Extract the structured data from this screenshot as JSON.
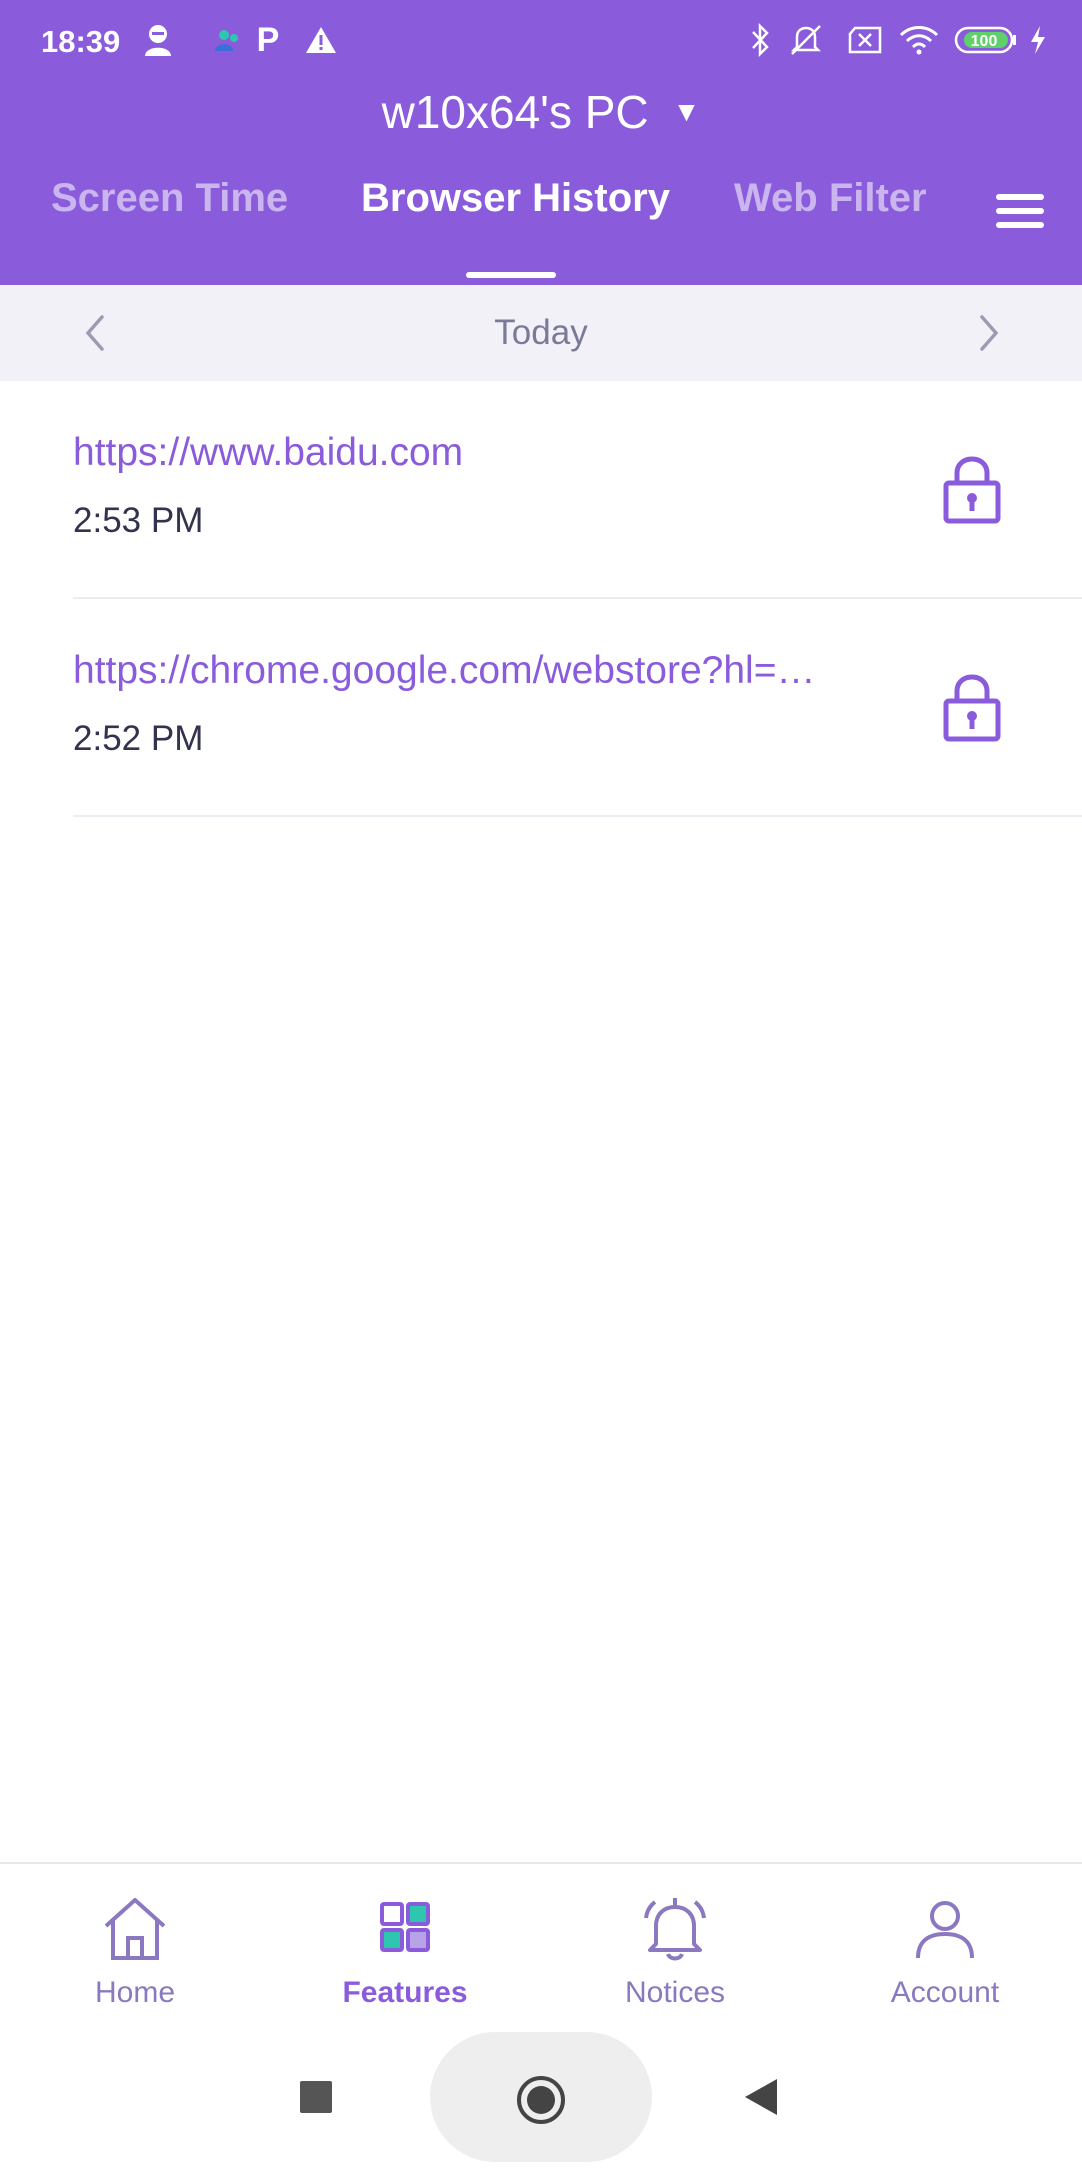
{
  "status_bar": {
    "time": "18:39",
    "battery": "100",
    "icons": [
      "face-icon",
      "people-icon",
      "parking-icon",
      "warning-icon",
      "bluetooth-icon",
      "muted-bell-icon",
      "sim-x-icon",
      "wifi-icon",
      "battery-icon",
      "charging-icon"
    ]
  },
  "header": {
    "device_name": "w10x64's PC",
    "caret": "▼",
    "tabs": [
      {
        "label": "Screen Time",
        "active": false
      },
      {
        "label": "Browser History",
        "active": true
      },
      {
        "label": "Web Filter",
        "active": false
      }
    ]
  },
  "date_nav": {
    "label": "Today"
  },
  "history": [
    {
      "url": "https://www.baidu.com",
      "time": "2:53 PM"
    },
    {
      "url": "https://chrome.google.com/webstore?hl=…",
      "time": "2:52 PM"
    }
  ],
  "bottom_nav": [
    {
      "label": "Home",
      "icon": "home-icon",
      "active": false
    },
    {
      "label": "Features",
      "icon": "features-icon",
      "active": true
    },
    {
      "label": "Notices",
      "icon": "bell-icon",
      "active": false
    },
    {
      "label": "Account",
      "icon": "account-icon",
      "active": false
    }
  ],
  "colors": {
    "accent": "#8a5cdc",
    "header_bg": "#8a5cdc",
    "date_bar_bg": "#f3f1f8",
    "feature_green": "#2fc6b0"
  }
}
